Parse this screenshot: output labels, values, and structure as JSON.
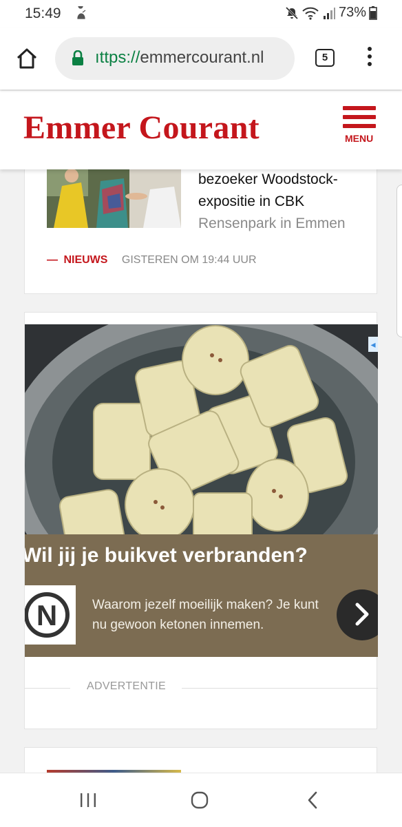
{
  "status_bar": {
    "time": "15:49",
    "battery": "73%",
    "icons": [
      "notification-icon",
      "mute-icon",
      "wifi-icon",
      "signal-icon",
      "battery-icon"
    ]
  },
  "browser": {
    "url_scheme": "ıttps://",
    "url_host": "emmercourant.nl",
    "tab_count": "5",
    "icons": [
      "home-icon",
      "lock-icon",
      "tabs-icon",
      "more-vert-icon"
    ]
  },
  "site": {
    "logo": "Emmer Courant",
    "menu_label": "MENU",
    "brand_color": "#c4161c"
  },
  "article_card": {
    "headline_lines": [
      "bezoeker Woodstock-",
      "expositie in CBK"
    ],
    "headline_faded": "Rensenpark in Emmen",
    "category": "NIEUWS",
    "time": "GISTEREN OM 19:44 UUR"
  },
  "ad": {
    "title": "Wil jij je buikvet verbranden?",
    "description": "Waarom jezelf moeilijk maken? Je kunt nu gewoon ketonen innemen.",
    "logo_letter": "N",
    "label": "ADVERTENTIE",
    "icons": [
      "adchoices-icon",
      "chevron-right-icon"
    ]
  },
  "nav_bar": {
    "icons": [
      "recent-apps-icon",
      "home-circle-icon",
      "back-icon"
    ]
  }
}
